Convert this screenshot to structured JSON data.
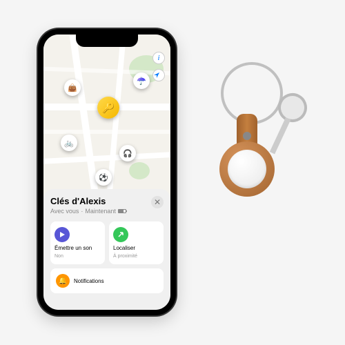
{
  "map": {
    "info_icon": "i",
    "pins": {
      "key": "🔑",
      "bag": "👜",
      "umbrella": "☂️",
      "bike": "🚲",
      "headphones": "🎧",
      "ball": "⚽"
    }
  },
  "sheet": {
    "title": "Clés d'Alexis",
    "subtitle_prefix": "Avec vous",
    "subtitle_time": "Maintenant",
    "close_glyph": "✕",
    "actions": {
      "sound": {
        "label": "Émettre un son",
        "sub": "Non",
        "icon": "▶"
      },
      "locate": {
        "label": "Localiser",
        "sub": "À proximité",
        "icon": "↗"
      }
    },
    "notifications": {
      "label": "Notifications",
      "icon": "🔔"
    }
  },
  "accessory": {
    "logo": ""
  }
}
